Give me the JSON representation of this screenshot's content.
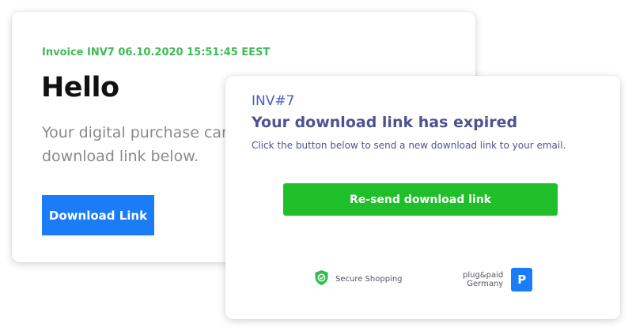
{
  "email": {
    "invoice_line": "Invoice INV7 06.10.2020 15:51:45 EEST",
    "greeting": "Hello",
    "body": "Your digital purchase can r the download link below.",
    "download_button": "Download Link"
  },
  "expired": {
    "invoice_number": "INV#7",
    "title": "Your download link has expired",
    "subtitle": "Click the button below to send a new download link to your email.",
    "resend_button": "Re-send download link",
    "secure_label": "Secure Shopping",
    "secure_icon": "shield-check-icon",
    "brand_name": "plug&paid",
    "brand_country": "Germany",
    "brand_logo_letter": "P"
  },
  "colors": {
    "invoice_green": "#3fbb56",
    "download_blue": "#1a7cf7",
    "resend_green": "#1fbf29",
    "title_navy": "#4f528f",
    "inv_blue": "#4a5dc4",
    "shield_green": "#2ec04a"
  }
}
